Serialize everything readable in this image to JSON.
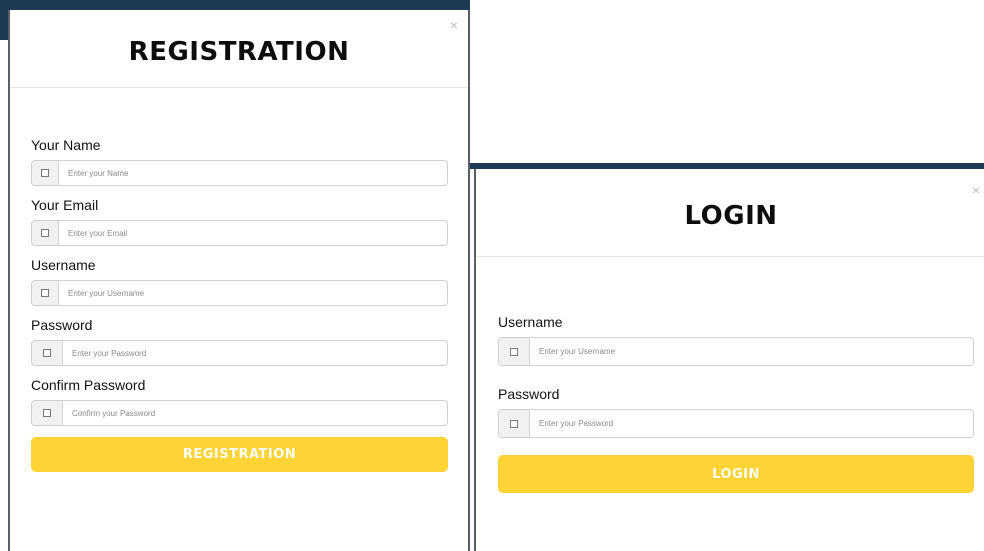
{
  "registration": {
    "title": "REGISTRATION",
    "close": "×",
    "fields": [
      {
        "label": "Your Name",
        "placeholder": "Enter your Name",
        "icon": "square-icon"
      },
      {
        "label": "Your Email",
        "placeholder": "Enter your Email",
        "icon": "square-icon"
      },
      {
        "label": "Username",
        "placeholder": "Enter your Username",
        "icon": "square-icon"
      },
      {
        "label": "Password",
        "placeholder": "Enter your Password",
        "icon": "square-icon"
      },
      {
        "label": "Confirm Password",
        "placeholder": "Confirm your Password",
        "icon": "square-icon"
      }
    ],
    "submit_label": "REGISTRATION"
  },
  "login": {
    "title": "LOGIN",
    "close": "×",
    "fields": [
      {
        "label": "Username",
        "placeholder": "Enter your Username",
        "icon": "square-icon"
      },
      {
        "label": "Password",
        "placeholder": "Enter your Password",
        "icon": "square-icon"
      }
    ],
    "submit_label": "LOGIN"
  },
  "colors": {
    "accent": "#fdd335",
    "frame": "#1f3a55",
    "title": "#0d0d0d"
  }
}
